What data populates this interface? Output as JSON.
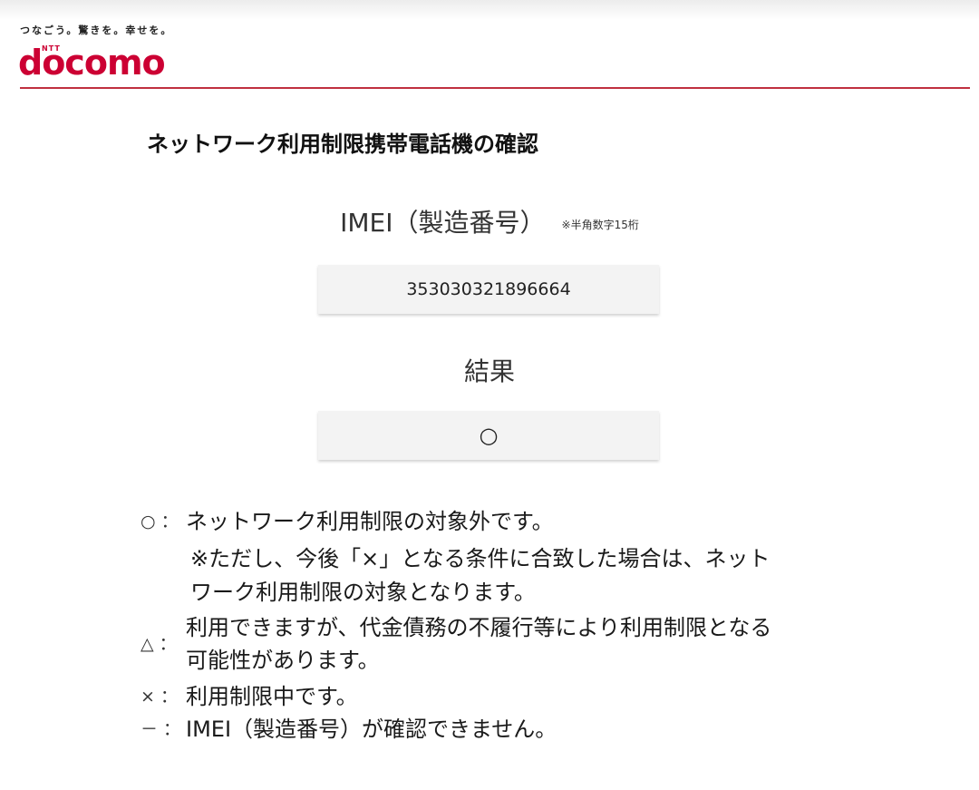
{
  "header": {
    "tagline": "つなごう。驚きを。幸せを。",
    "logo_sup": "NTT",
    "logo": "docomo",
    "accent_color": "#cc0033"
  },
  "page_title": "ネットワーク利用制限携帯電話機の確認",
  "imei": {
    "label": "IMEI（製造番号）",
    "note": "※半角数字15桁",
    "value": "353030321896664"
  },
  "result": {
    "label": "結果",
    "value": "○"
  },
  "legend": {
    "circle": {
      "symbol": "○ ：",
      "text": "ネットワーク利用制限の対象外です。",
      "note_line1": "※ただし、今後「×」となる条件に合致した場合は、ネット",
      "note_line2": "ワーク利用制限の対象となります。"
    },
    "triangle": {
      "symbol": "△ ：",
      "text_line1": "利用できますが、代金債務の不履行等により利用制限となる",
      "text_line2": "可能性があります。"
    },
    "cross": {
      "symbol": "× ：",
      "text": "利用制限中です。"
    },
    "dash": {
      "symbol": "－ ：",
      "text": "IMEI（製造番号）が確認できません。"
    }
  }
}
